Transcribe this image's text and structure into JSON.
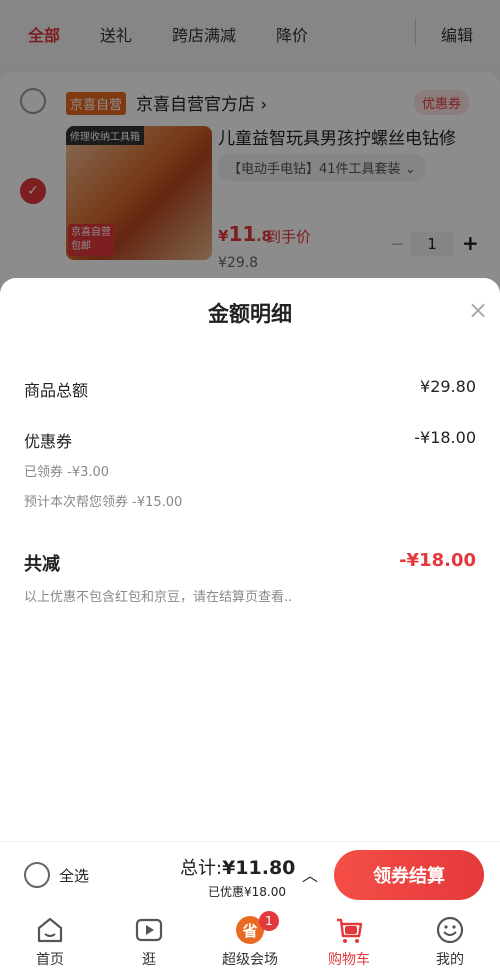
{
  "top_tabs": [
    {
      "label": "全部"
    },
    {
      "label": "送礼"
    },
    {
      "label": "跨店满减"
    },
    {
      "label": "降价"
    }
  ],
  "edit_label": "编辑",
  "store": {
    "tag": "京喜自营",
    "name": "京喜自营官方店",
    "coupon_tag": "优惠券"
  },
  "product": {
    "image_banner": "修理收纳工具箱",
    "image_badge_line1": "京喜自营",
    "image_badge_line2": "包邮",
    "title": "儿童益智玩具男孩拧螺丝电钻修",
    "variant": "【电动手电钻】41件工具套装",
    "price_symbol": "¥",
    "price_int": "11",
    "price_dec": ".8",
    "price_note": "到手价",
    "old_price": "¥29.8",
    "quantity": "1",
    "minus": "−",
    "plus": "+"
  },
  "sheet": {
    "title": "金额明细",
    "close": "×",
    "goods_total_label": "商品总额",
    "goods_total_value": "¥29.80",
    "coupon_label": "优惠券",
    "coupon_value": "-¥18.00",
    "claimed_label": "已领券 -¥3.00",
    "estimated_label": "预计本次帮您领券 -¥15.00",
    "total_reduction_label": "共减",
    "total_reduction_value": "-¥18.00",
    "footnote": "以上优惠不包含红包和京豆，请在结算页查看.."
  },
  "checkout": {
    "select_all_label": "全选",
    "total_prefix": "总计:",
    "total_value": "¥11.80",
    "discount_note": "已优惠¥18.00",
    "button_label": "领券结算"
  },
  "tabbar": [
    {
      "label": "首页",
      "icon": "home-icon"
    },
    {
      "label": "逛",
      "icon": "video-play-icon"
    },
    {
      "label": "超级会场",
      "icon": "super-venue-icon",
      "badge": "1"
    },
    {
      "label": "购物车",
      "icon": "cart-icon"
    },
    {
      "label": "我的",
      "icon": "smiley-face-icon"
    }
  ],
  "colors": {
    "accent": "#e4393c",
    "store_tag": "#e96a22"
  }
}
